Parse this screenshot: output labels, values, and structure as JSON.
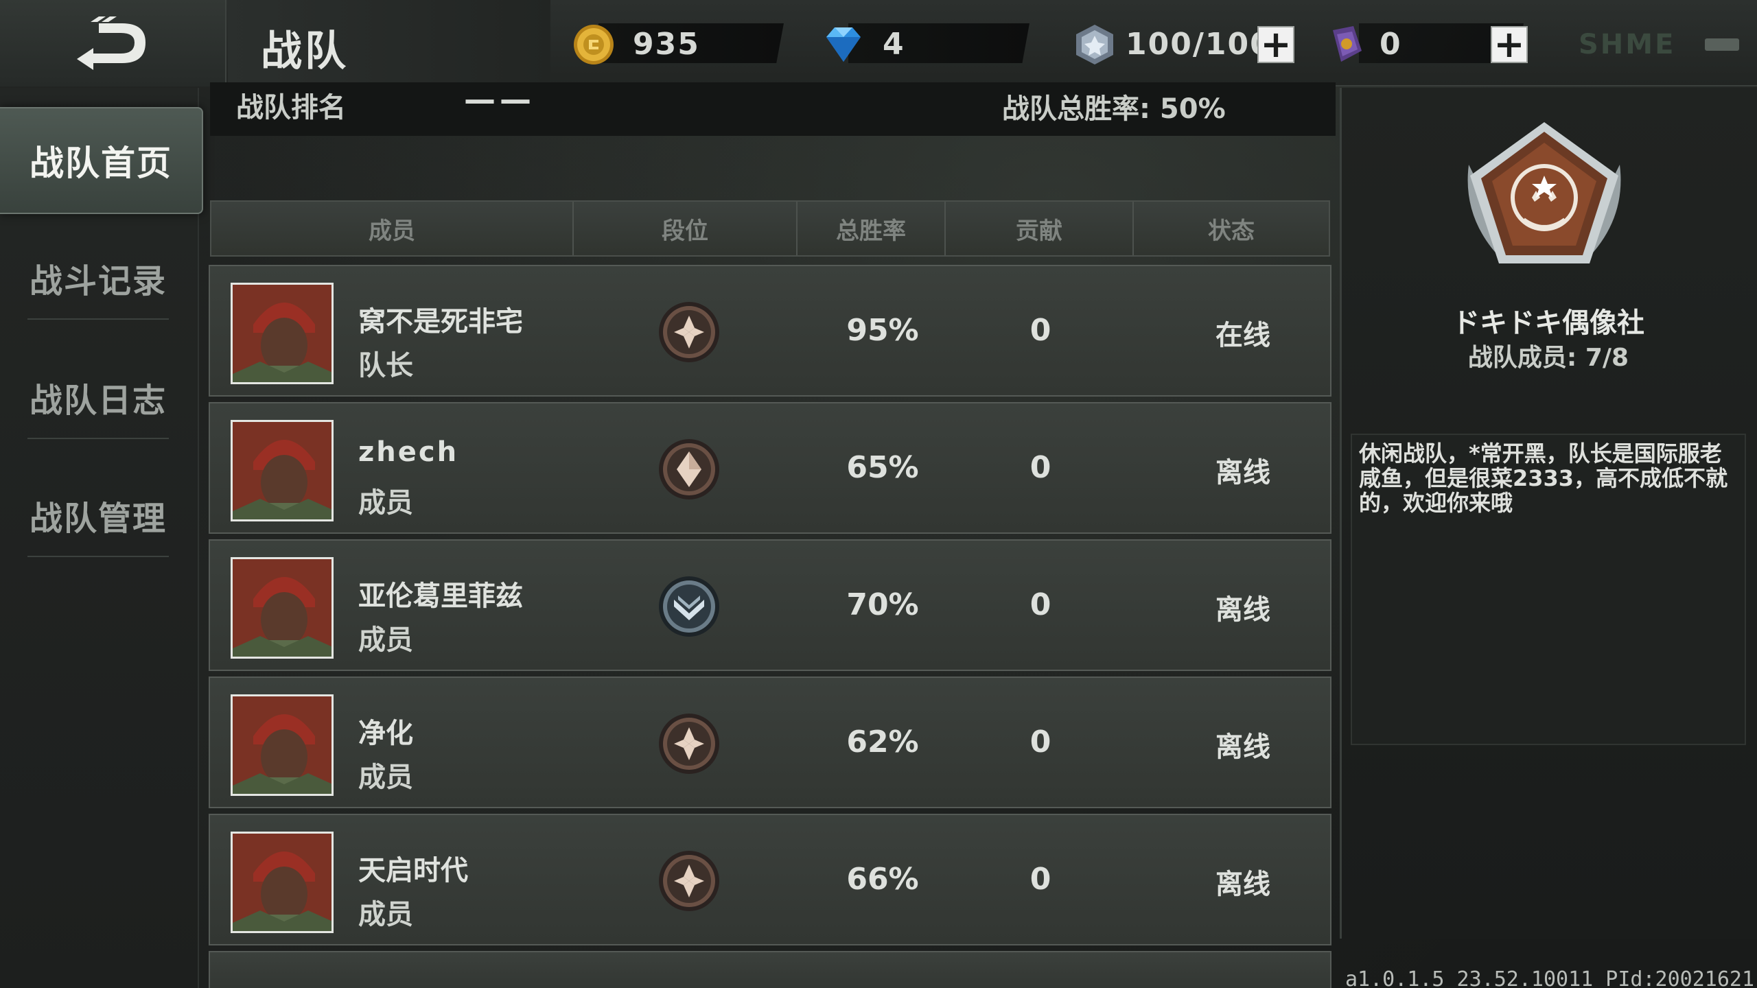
{
  "header": {
    "title": "战队",
    "coins": "935",
    "diamonds": "4",
    "stamina": "100/100",
    "tickets": "0",
    "faded_label": "SHME"
  },
  "subheader": {
    "rank_label": "战队排名",
    "rank_value": "——",
    "winrate_label": "战队总胜率: 50%"
  },
  "nav": {
    "items": [
      {
        "label": "战队首页",
        "active": true
      },
      {
        "label": "战斗记录",
        "active": false
      },
      {
        "label": "战队日志",
        "active": false
      },
      {
        "label": "战队管理",
        "active": false
      }
    ]
  },
  "table": {
    "headers": [
      "成员",
      "段位",
      "总胜率",
      "贡献",
      "状态"
    ],
    "rows": [
      {
        "name": "窝不是死非宅",
        "role": "队长",
        "rank_icon": "rank-bronze-diamond-icon",
        "winrate": "95%",
        "contribution": "0",
        "status": "在线"
      },
      {
        "name": "zhech",
        "role": "成员",
        "rank_icon": "rank-bronze-single-icon",
        "winrate": "65%",
        "contribution": "0",
        "status": "离线"
      },
      {
        "name": "亚伦葛里菲兹",
        "role": "成员",
        "rank_icon": "rank-silver-chevron-icon",
        "winrate": "70%",
        "contribution": "0",
        "status": "离线"
      },
      {
        "name": "净化",
        "role": "成员",
        "rank_icon": "rank-bronze-diamond-icon",
        "winrate": "62%",
        "contribution": "0",
        "status": "离线"
      },
      {
        "name": "天启时代",
        "role": "成员",
        "rank_icon": "rank-bronze-diamond-icon",
        "winrate": "66%",
        "contribution": "0",
        "status": "离线"
      }
    ]
  },
  "team": {
    "name": "ドキドキ偶像社",
    "members": "战队成员: 7/8",
    "description": "休闲战队，*常开黑，队长是国际服老咸鱼，但是很菜2333，高不成低不就的，欢迎你来哦"
  },
  "footer": {
    "version": "a1.0.1.5 23.52.10011 PId:20021621"
  },
  "colors": {
    "accent_active_tab": "#4e5953",
    "row_bg": "#3b403c",
    "coin_gold": "#d4a12a",
    "diamond_blue": "#3aa8f0"
  }
}
